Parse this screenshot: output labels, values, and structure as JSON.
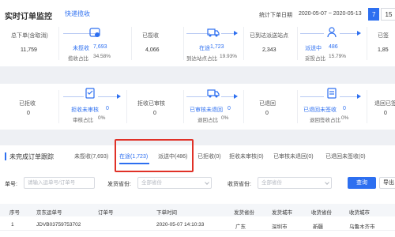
{
  "header": {
    "title": "实时订单监控",
    "quick_tab": "快递揽收",
    "date_label": "统计下单日期",
    "date_range": "2020-05-07 ~ 2020-05-13",
    "date_active": "7日",
    "date_other": "15日"
  },
  "row1": {
    "total_label": "总下单(含取消)",
    "total_value": "11,759",
    "not_collected_label": "未揽收",
    "not_collected_value": "7,693",
    "not_collected_ratio_label": "揽收占比",
    "not_collected_ratio": "34.58%",
    "collected_label": "已揽收",
    "collected_value": "4,066",
    "in_transit_label": "在途",
    "in_transit_value": "1,723",
    "in_transit_ratio_label": "到达站点占比",
    "in_transit_ratio": "19.93%",
    "arrived_label": "已到达派送站点",
    "arrived_value": "2,343",
    "delivering_label": "派送中",
    "delivering_value": "486",
    "delivering_ratio_label": "妥投占比",
    "delivering_ratio": "15.79%",
    "signed_label": "已签",
    "signed_value": "1,85"
  },
  "row2": {
    "rejected_label": "已拒收",
    "rejected_value": "0",
    "reject_unreviewed_label": "拒收未审核",
    "reject_unreviewed_value": "0",
    "review_ratio_label": "审核占比",
    "review_ratio": "0%",
    "reject_reviewed_label": "拒收已审核",
    "reject_reviewed_value": "0",
    "reviewed_not_returned_label": "已审核未退回",
    "reviewed_not_returned_value": "0",
    "return_ratio_label": "退回占比",
    "return_ratio": "0%",
    "returned_label": "已退回",
    "returned_value": "0",
    "returned_unsigned_label": "已退回未签收",
    "returned_unsigned_value": "0",
    "return_signed_ratio_label": "退回签收占比",
    "return_signed_ratio": "0%",
    "returned_signed_label": "退回已签",
    "returned_signed_value": "0"
  },
  "tracking": {
    "title": "未完成订单跟踪",
    "tabs": [
      "未揽收(7,693)",
      "在途(1,723)",
      "派送中(486)",
      "已拒收(0)",
      "拒收未审核(0)",
      "已审核未退回(0)",
      "已退回未签收(0)"
    ],
    "form": {
      "order_label": "单号:",
      "order_placeholder": "请输入运单号/订单号",
      "ship_prov_label": "发货省份:",
      "ship_prov_placeholder": "全部省份",
      "recv_prov_label": "收货省份:",
      "recv_prov_placeholder": "全部省份",
      "search_button": "查询",
      "export_button": "导出"
    },
    "columns": [
      "序号",
      "京东运单号",
      "订单号",
      "下单时间",
      "发货省份",
      "发货城市",
      "收货省份",
      "收货城市"
    ],
    "rows": [
      [
        "1",
        "JDVB03759753702",
        "",
        "2020-05-07 14:10:33",
        "广东",
        "深圳市",
        "新疆",
        "乌鲁木齐市"
      ]
    ]
  },
  "colors": {
    "accent": "#2d6ff0",
    "highlight": "#e03127"
  }
}
